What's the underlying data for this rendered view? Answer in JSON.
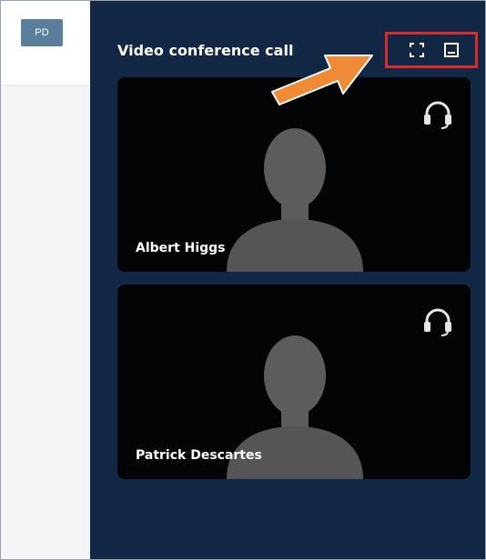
{
  "sidebar": {
    "avatar_initials": "PD"
  },
  "panel": {
    "title": "Video conference call",
    "controls": [
      {
        "name": "fullscreen-icon",
        "label": "Fullscreen"
      },
      {
        "name": "minimize-window-icon",
        "label": "Minimize"
      }
    ]
  },
  "participants": [
    {
      "name": "Albert Higgs",
      "status_icon": "headset-icon"
    },
    {
      "name": "Patrick Descartes",
      "status_icon": "headset-icon"
    }
  ],
  "colors": {
    "panel_bg": "#122743",
    "tile_bg": "#030406",
    "highlight": "#d92b2b",
    "arrow": "#ef8a37",
    "avatar_bg": "#5a7f9c"
  }
}
